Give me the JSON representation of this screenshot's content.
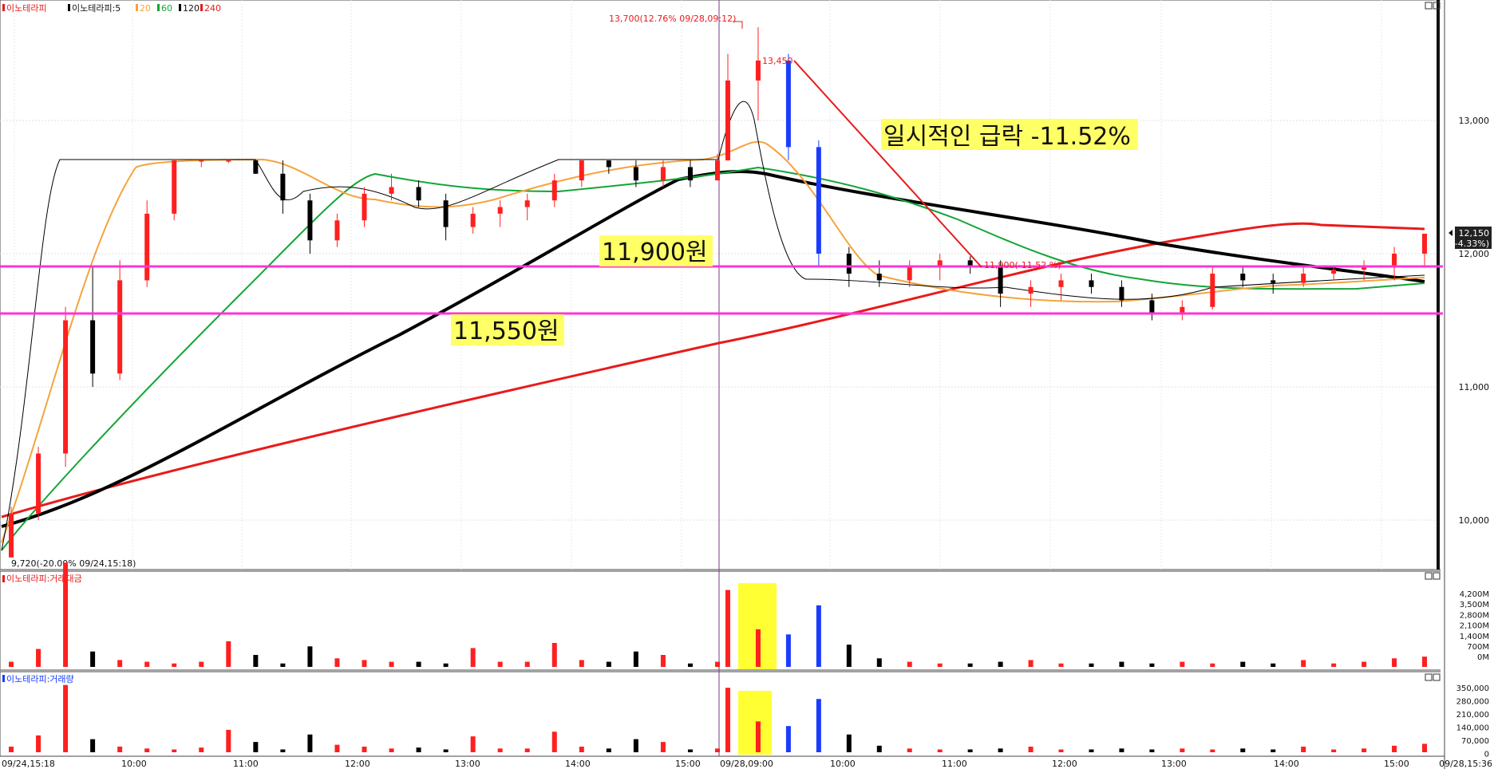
{
  "panels": {
    "price": {
      "legend": {
        "name": "이노테라피",
        "series": "이노테라피:5",
        "ma20": "20",
        "ma60": "60",
        "ma120": "120",
        "ma240": "240"
      },
      "current_price": "12,150",
      "current_change": "(-4.33%)",
      "y_ticks": [
        "13,000",
        "12,000",
        "11,000",
        "10,000"
      ]
    },
    "amount": {
      "legend": "이노테라피:거래대금",
      "y_ticks": [
        "4,200M",
        "3,500M",
        "2,800M",
        "2,100M",
        "1,400M",
        "700M",
        "0M"
      ]
    },
    "volume": {
      "legend": "이노테라피:거래량",
      "y_ticks": [
        "350,000",
        "280,000",
        "210,000",
        "140,000",
        "70,000",
        "0"
      ]
    }
  },
  "time_axis": [
    "09/24,15:18",
    "10:00",
    "11:00",
    "12:00",
    "13:00",
    "14:00",
    "15:00",
    "09/28,09:00",
    "10:00",
    "11:00",
    "12:00",
    "13:00",
    "14:00",
    "15:00",
    "09/28,15:36"
  ],
  "annotations": {
    "high_label": "13,700(12.76% 09/28,09:12)",
    "peak_label": "13,450",
    "low_label": "9,720(-20.00% 09/24,15:18)",
    "mid_label": "11,900(-11.52 %)",
    "drop_text": "일시적인 급락 -11.52%",
    "level1_text": "11,900원",
    "level2_text": "11,550원"
  },
  "colors": {
    "up": "#ff1f1f",
    "down": "#000000",
    "ma5": "#000000",
    "ma20": "#f5a33c",
    "ma60": "#12a536",
    "ma120": "#000000",
    "ma240": "#e81b1b",
    "support": "#ff33d8",
    "highlight": "#ffff66",
    "blue": "#1a3cff"
  },
  "chart_data": {
    "type": "candlestick",
    "title": "",
    "ylim": [
      9600,
      13900
    ],
    "support_levels": [
      11900,
      11550
    ],
    "candles": [
      [
        9720,
        10100,
        9720,
        10050
      ],
      [
        10050,
        10550,
        10000,
        10500
      ],
      [
        10500,
        11600,
        10400,
        11500
      ],
      [
        11500,
        11900,
        11000,
        11100
      ],
      [
        11100,
        11950,
        11050,
        11800
      ],
      [
        11800,
        12400,
        11750,
        12300
      ],
      [
        12300,
        12700,
        12250,
        12700
      ],
      [
        12700,
        12700,
        12650,
        12700
      ],
      [
        12700,
        12700,
        12680,
        12700
      ],
      [
        12700,
        12700,
        12600,
        12600
      ],
      [
        12600,
        12700,
        12300,
        12400
      ],
      [
        12400,
        12450,
        12000,
        12100
      ],
      [
        12100,
        12300,
        12050,
        12250
      ],
      [
        12250,
        12500,
        12200,
        12450
      ],
      [
        12450,
        12600,
        12400,
        12500
      ],
      [
        12500,
        12550,
        12350,
        12400
      ],
      [
        12400,
        12450,
        12100,
        12200
      ],
      [
        12200,
        12350,
        12150,
        12300
      ],
      [
        12300,
        12400,
        12200,
        12350
      ],
      [
        12350,
        12450,
        12250,
        12400
      ],
      [
        12400,
        12600,
        12350,
        12550
      ],
      [
        12550,
        12700,
        12500,
        12700
      ],
      [
        12700,
        12700,
        12600,
        12650
      ],
      [
        12650,
        12700,
        12500,
        12550
      ],
      [
        12550,
        12700,
        12500,
        12650
      ],
      [
        12650,
        12700,
        12500,
        12550
      ],
      [
        12550,
        12750,
        12550,
        12700
      ],
      [
        12700,
        13500,
        12700,
        13300
      ],
      [
        13300,
        13700,
        13000,
        13450
      ],
      [
        13450,
        13500,
        12700,
        12800
      ],
      [
        12800,
        12850,
        11900,
        12000
      ],
      [
        12000,
        12050,
        11750,
        11850
      ],
      [
        11850,
        11950,
        11750,
        11800
      ],
      [
        11800,
        11950,
        11750,
        11900
      ],
      [
        11900,
        12000,
        11800,
        11950
      ],
      [
        11950,
        11980,
        11850,
        11900
      ],
      [
        11900,
        11950,
        11600,
        11700
      ],
      [
        11700,
        11800,
        11600,
        11750
      ],
      [
        11750,
        11850,
        11650,
        11800
      ],
      [
        11800,
        11850,
        11700,
        11750
      ],
      [
        11750,
        11800,
        11600,
        11650
      ],
      [
        11650,
        11700,
        11500,
        11550
      ],
      [
        11550,
        11650,
        11500,
        11600
      ],
      [
        11600,
        11900,
        11580,
        11850
      ],
      [
        11850,
        11900,
        11750,
        11800
      ],
      [
        11800,
        11850,
        11700,
        11780
      ],
      [
        11780,
        11900,
        11750,
        11850
      ],
      [
        11850,
        11900,
        11800,
        11880
      ],
      [
        11880,
        11950,
        11800,
        11900
      ],
      [
        11900,
        12050,
        11800,
        12000
      ],
      [
        12000,
        12100,
        11900,
        12150
      ]
    ],
    "amount_m": [
      300,
      1050,
      6100,
      900,
      400,
      300,
      200,
      300,
      1500,
      700,
      200,
      1200,
      500,
      400,
      300,
      300,
      200,
      1100,
      300,
      300,
      1400,
      400,
      300,
      900,
      700,
      200,
      300,
      4500,
      2200,
      1900,
      3600,
      1300,
      500,
      300,
      200,
      200,
      300,
      400,
      200,
      200,
      300,
      200,
      300,
      200,
      300,
      200,
      400,
      200,
      300,
      500,
      600
    ],
    "volume": [
      30000,
      90000,
      360000,
      70000,
      30000,
      20000,
      15000,
      25000,
      120000,
      55000,
      15000,
      95000,
      40000,
      30000,
      20000,
      25000,
      15000,
      85000,
      20000,
      20000,
      110000,
      30000,
      20000,
      70000,
      55000,
      15000,
      20000,
      345000,
      165000,
      140000,
      285000,
      95000,
      35000,
      20000,
      15000,
      15000,
      20000,
      30000,
      15000,
      15000,
      20000,
      15000,
      20000,
      15000,
      20000,
      15000,
      30000,
      15000,
      20000,
      35000,
      45000
    ]
  }
}
